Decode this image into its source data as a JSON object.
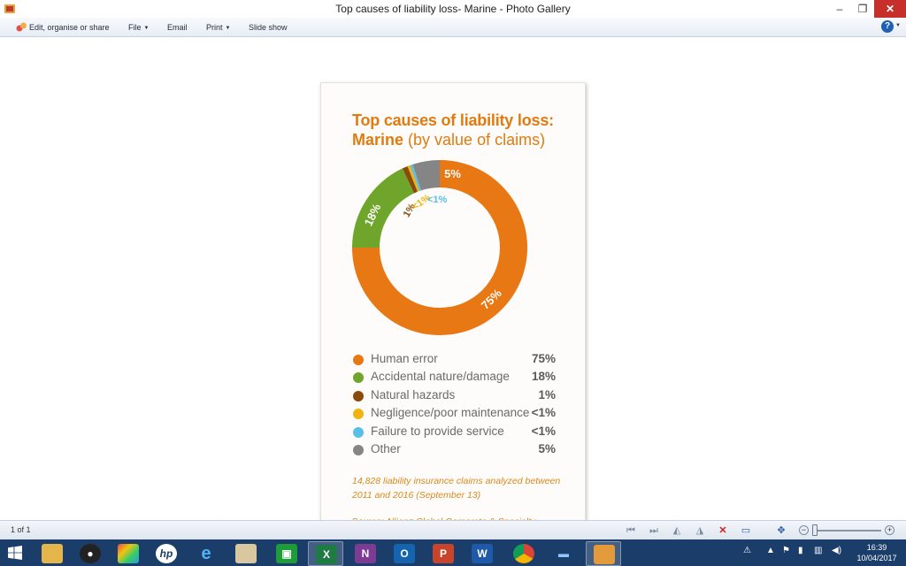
{
  "window": {
    "title": "Top causes of liability loss- Marine - Photo Gallery",
    "minimize": "–",
    "maximize": "❐",
    "close": "✕"
  },
  "menu": {
    "edit": "Edit, organise or share",
    "file": "File",
    "email": "Email",
    "print": "Print",
    "slideshow": "Slide show",
    "help": "?"
  },
  "photo": {
    "title_line1": "Top causes of liability loss:",
    "title_line2_bold": "Marine",
    "title_line2_rest": " (by value of claims)",
    "note": "14,828 liability insurance claims analyzed between 2011 and 2016 (September 13)",
    "source": "Source: Allianz Global Corporate & Specialty"
  },
  "chart_data": {
    "type": "pie",
    "title": "Top causes of liability loss: Marine (by value of claims)",
    "categories": [
      "Human error",
      "Accidental nature/damage",
      "Natural hazards",
      "Negligence/poor maintenance",
      "Failure to provide service",
      "Other"
    ],
    "value_labels": [
      "75%",
      "18%",
      "1%",
      "<1%",
      "<1%",
      "5%"
    ],
    "values": [
      75,
      18,
      1,
      0.5,
      0.5,
      5
    ],
    "colors": [
      "#e77814",
      "#6fa52a",
      "#8b4a0c",
      "#f0b30f",
      "#58bfe6",
      "#858585"
    ],
    "label_colors": [
      "#ffffff",
      "#ffffff",
      "#8b4a0c",
      "#f0b30f",
      "#58bfe6",
      "#ffffff"
    ],
    "donut": true,
    "legend_position": "bottom"
  },
  "status": {
    "page_count": "1 of 1"
  },
  "taskbar": {
    "time": "16:39",
    "date": "10/04/2017"
  },
  "icons": {
    "start": "windows-logo-icon",
    "apps": [
      "file-explorer-icon",
      "webcam-icon",
      "media-center-icon",
      "hp-icon",
      "internet-explorer-icon",
      "paint-icon",
      "store-icon",
      "excel-icon",
      "onenote-icon",
      "outlook-icon",
      "powerpoint-icon",
      "word-icon",
      "chrome-icon",
      "scanner-icon",
      "photo-gallery-icon"
    ]
  }
}
